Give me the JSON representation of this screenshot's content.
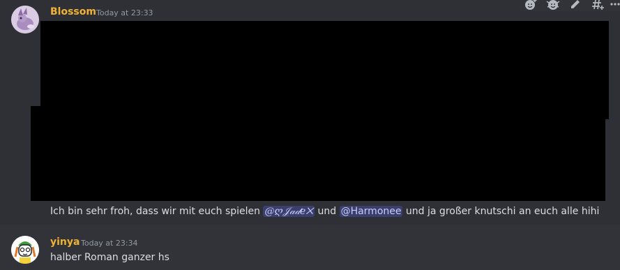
{
  "messages": [
    {
      "username": "Blossom",
      "timestamp": "Today at 23:33",
      "avatar_icon": "purple-creature-avatar",
      "text_before": "Ich bin sehr froh, dass wir mit euch spielen ",
      "mention1": "@ღ𝒥𝒶𝒹𝑒✕",
      "text_middle": " und ",
      "mention2": "@Harmonee",
      "text_after": " und ja großer knutschi an euch alle hihi"
    },
    {
      "username": "yinya",
      "timestamp": "Today at 23:34",
      "avatar_icon": "cartoon-character-avatar",
      "text": "halber Roman ganzer hs"
    }
  ],
  "toolbar": {
    "icons": [
      "add-reaction-icon",
      "super-reaction-icon",
      "edit-icon",
      "create-thread-icon",
      "more-icon"
    ]
  },
  "colors": {
    "background": "#313338",
    "username": "#f0b232",
    "mention_bg": "#3c4270",
    "text": "#dbdee1"
  }
}
